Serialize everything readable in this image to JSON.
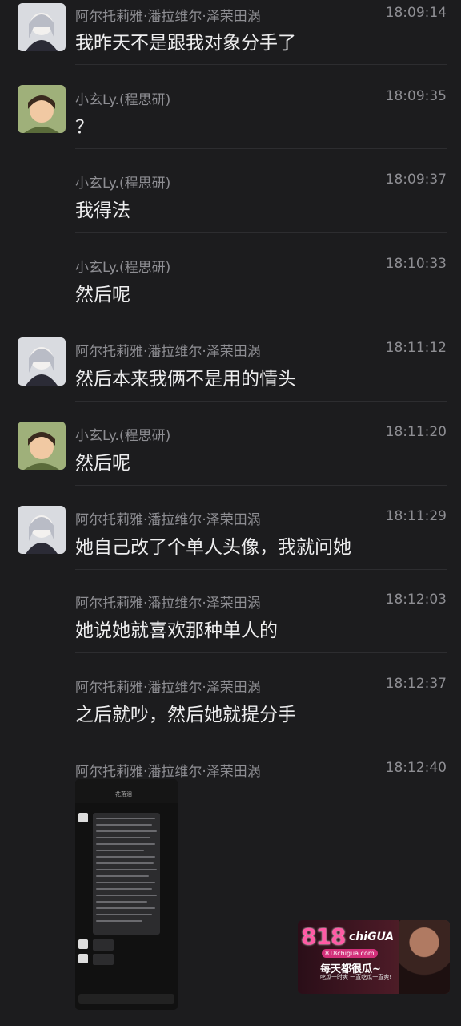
{
  "messages": [
    {
      "name": "阿尔托莉雅·潘拉维尔·泽荣田涡",
      "time": "18:09:14",
      "text": "我昨天不是跟我对象分手了",
      "avatar": "girl-avatar"
    },
    {
      "name": "小玄Ly.(程思研)",
      "time": "18:09:35",
      "text": "？",
      "avatar": "boy-avatar"
    },
    {
      "name": "小玄Ly.(程思研)",
      "time": "18:09:37",
      "text": "我得法",
      "avatar": ""
    },
    {
      "name": "小玄Ly.(程思研)",
      "time": "18:10:33",
      "text": "然后呢",
      "avatar": ""
    },
    {
      "name": "阿尔托莉雅·潘拉维尔·泽荣田涡",
      "time": "18:11:12",
      "text": "然后本来我俩不是用的情头",
      "avatar": "girl-avatar"
    },
    {
      "name": "小玄Ly.(程思研)",
      "time": "18:11:20",
      "text": "然后呢",
      "avatar": "boy-avatar"
    },
    {
      "name": "阿尔托莉雅·潘拉维尔·泽荣田涡",
      "time": "18:11:29",
      "text": "她自己改了个单人头像，我就问她",
      "avatar": "girl-avatar"
    },
    {
      "name": "阿尔托莉雅·潘拉维尔·泽荣田涡",
      "time": "18:12:03",
      "text": "她说她就喜欢那种单人的",
      "avatar": ""
    },
    {
      "name": "阿尔托莉雅·潘拉维尔·泽荣田涡",
      "time": "18:12:37",
      "text": "之后就吵，然后她就提分手",
      "avatar": ""
    },
    {
      "name": "阿尔托莉雅·潘拉维尔·泽荣田涡",
      "time": "18:12:40",
      "text": "",
      "avatar": ""
    }
  ],
  "screenshot": {
    "header": "花落泪"
  },
  "ad": {
    "logo": "818",
    "logo_suffix": "chiGUA",
    "url": "818chigua.com",
    "slogan": "每天都很瓜~",
    "sub": "吃瓜一时爽 一直吃瓜一直爽!"
  },
  "colors": {
    "background": "#1c1c1e",
    "name": "#8e8e93",
    "text": "#ededee",
    "divider": "#2d2d30"
  }
}
